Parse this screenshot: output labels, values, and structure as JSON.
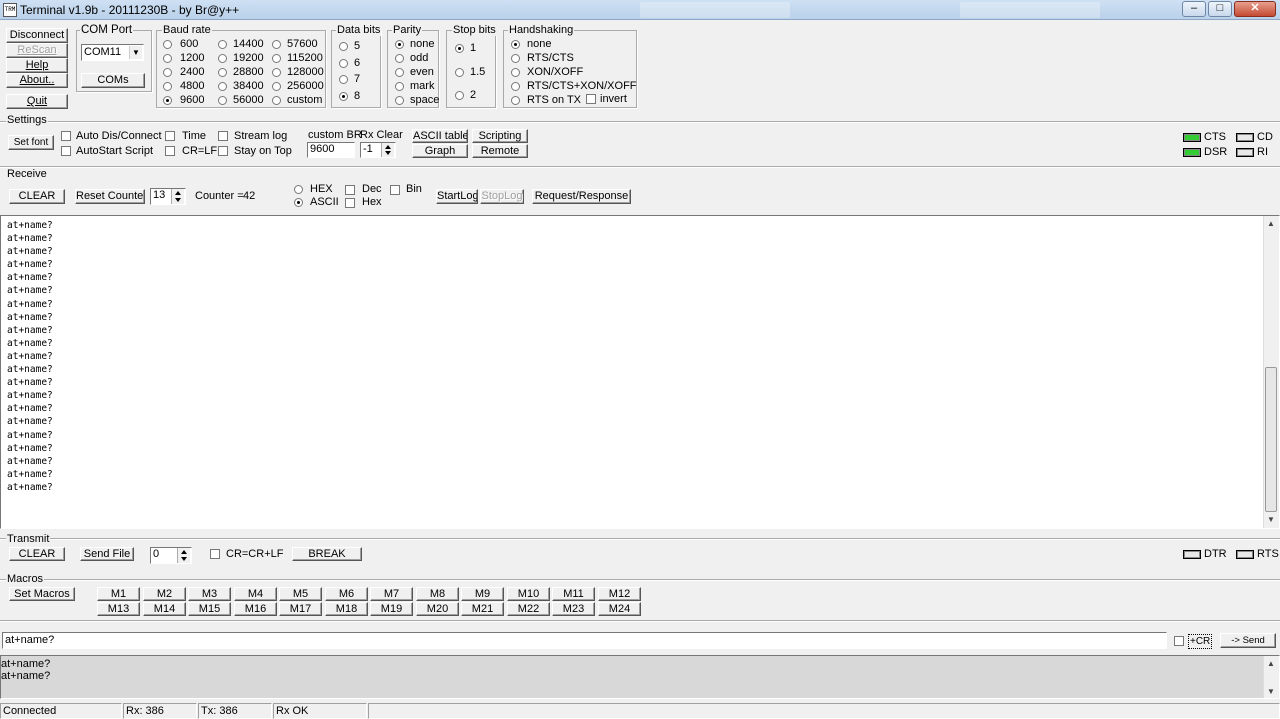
{
  "window": {
    "title": "Terminal v1.9b - 20111230B - by Br@y++",
    "icon_text": "TRM",
    "controls": [
      "minimize-icon",
      "maximize-icon",
      "close-icon"
    ]
  },
  "left_buttons": {
    "disconnect": "Disconnect",
    "rescan": "ReScan",
    "help": "Help",
    "about": "About..",
    "quit": "Quit"
  },
  "com_port": {
    "group": "COM Port",
    "selected": "COM11",
    "coms_button": "COMs"
  },
  "baud_rate": {
    "group": "Baud rate",
    "options": [
      "600",
      "1200",
      "2400",
      "4800",
      "9600",
      "14400",
      "19200",
      "28800",
      "38400",
      "56000",
      "57600",
      "115200",
      "128000",
      "256000",
      "custom"
    ],
    "selected": "9600"
  },
  "data_bits": {
    "group": "Data bits",
    "options": [
      "5",
      "6",
      "7",
      "8"
    ],
    "selected": "8"
  },
  "parity": {
    "group": "Parity",
    "options": [
      "none",
      "odd",
      "even",
      "mark",
      "space"
    ],
    "selected": "none"
  },
  "stop_bits": {
    "group": "Stop bits",
    "options": [
      "1",
      "1.5",
      "2"
    ],
    "selected": "1"
  },
  "handshaking": {
    "group": "Handshaking",
    "options": [
      "none",
      "RTS/CTS",
      "XON/XOFF",
      "RTS/CTS+XON/XOFF",
      "RTS on TX"
    ],
    "selected": "none",
    "invert_label": "invert"
  },
  "settings": {
    "group": "Settings",
    "set_font": "Set font",
    "auto_dis_connect": "Auto Dis/Connect",
    "autostart_script": "AutoStart Script",
    "time": "Time",
    "cr_lf": "CR=LF",
    "stream_log": "Stream log",
    "stay_on_top": "Stay on Top",
    "custom_br_label": "custom BR",
    "custom_br_value": "9600",
    "rx_clear_label": "Rx Clear",
    "rx_clear_value": "-1",
    "ascii_table": "ASCII table",
    "scripting": "Scripting",
    "graph": "Graph",
    "remote": "Remote"
  },
  "signals": {
    "cts": "CTS",
    "cd": "CD",
    "dsr": "DSR",
    "ri": "RI",
    "cts_on": true,
    "cd_on": false,
    "dsr_on": true,
    "ri_on": false,
    "on_color": "#33cc33",
    "off_color": "#e8e8e8"
  },
  "receive": {
    "group": "Receive",
    "clear": "CLEAR",
    "reset_counter": "Reset Counter",
    "counter_step": "13",
    "counter_label": "Counter =",
    "counter_value": "42",
    "hex_label": "HEX",
    "ascii_label": "ASCII",
    "mode_selected": "ASCII",
    "dec": "Dec",
    "hex_small": "Hex",
    "bin": "Bin",
    "startlog": "StartLog",
    "stoplog": "StopLog",
    "request_response": "Request/Response",
    "lines": [
      "at+name?",
      "at+name?",
      "at+name?",
      "at+name?",
      "at+name?",
      "at+name?",
      "at+name?",
      "at+name?",
      "at+name?",
      "at+name?",
      "at+name?",
      "at+name?",
      "at+name?",
      "at+name?",
      "at+name?",
      "at+name?",
      "at+name?",
      "at+name?",
      "at+name?",
      "at+name?",
      "at+name?"
    ]
  },
  "transmit": {
    "group": "Transmit",
    "clear": "CLEAR",
    "send_file": "Send File",
    "counter": "0",
    "cr_crlf": "CR=CR+LF",
    "break": "BREAK",
    "dtr": "DTR",
    "rts": "RTS"
  },
  "macros": {
    "group": "Macros",
    "set_macros": "Set Macros",
    "row1": [
      "M1",
      "M2",
      "M3",
      "M4",
      "M5",
      "M6",
      "M7",
      "M8",
      "M9",
      "M10",
      "M11",
      "M12"
    ],
    "row2": [
      "M13",
      "M14",
      "M15",
      "M16",
      "M17",
      "M18",
      "M19",
      "M20",
      "M21",
      "M22",
      "M23",
      "M24"
    ]
  },
  "send": {
    "input_value": "at+name?",
    "plus_cr": "+CR",
    "send_button": "-> Send",
    "sent_lines": [
      "at+name?",
      "at+name?"
    ]
  },
  "statusbar": {
    "connection": "Connected",
    "rx": "Rx: 386",
    "tx": "Tx: 386",
    "rx_status": "Rx OK"
  }
}
